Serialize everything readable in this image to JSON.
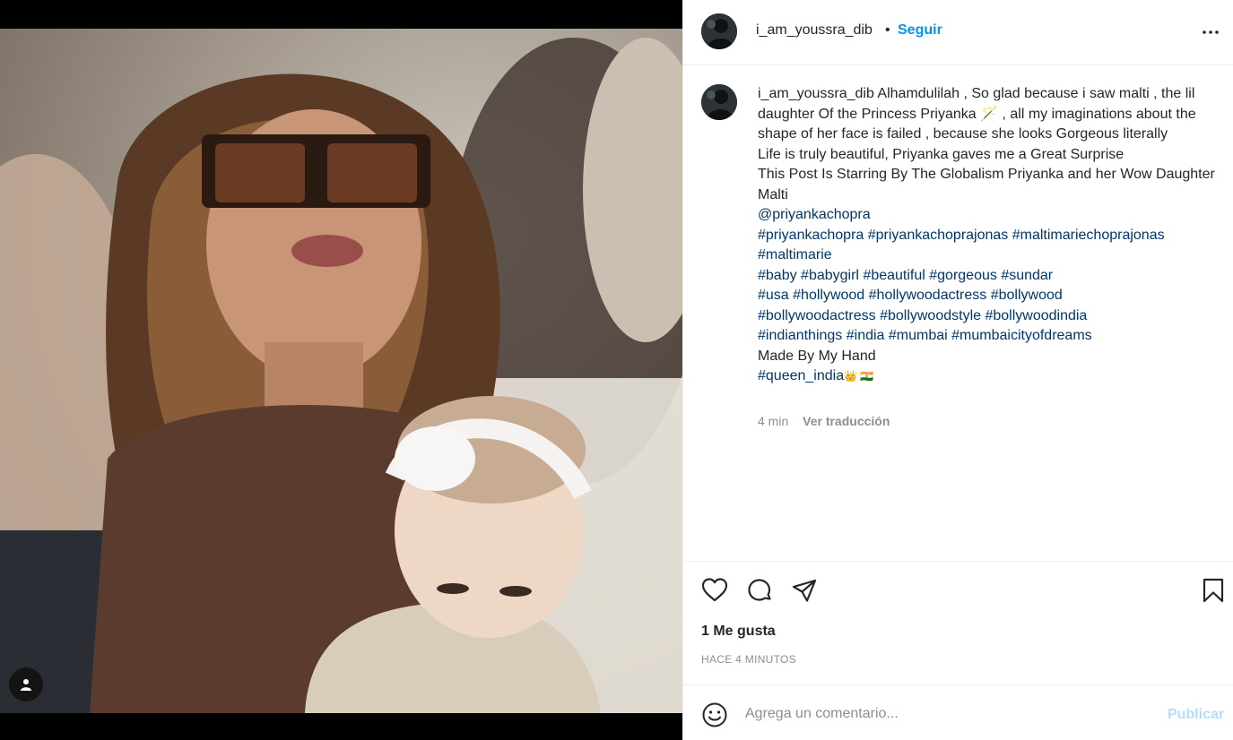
{
  "post": {
    "username": "i_am_youssra_dib",
    "separator": "•",
    "follow_label": "Seguir",
    "more_icon": "more-horizontal-icon"
  },
  "caption": {
    "username": "i_am_youssra_dib",
    "text_1": " Alhamdulilah , So glad because i saw malti , the lil daughter Of the Princess Priyanka 🪄 , all my imaginations about the shape of her face is failed , because she looks Gorgeous literally",
    "line_2": "Life is truly beautiful, Priyanka gaves me a Great Surprise",
    "line_3": "This Post Is Starring By The Globalism Priyanka and her Wow Daughter Malti",
    "mention": "@priyankachopra",
    "tags_1": "#priyankachopra #priyankachoprajonas #maltimariechoprajonas #maltimarie",
    "tags_2": "#baby #babygirl #beautiful #gorgeous #sundar",
    "tags_3": "#usa #hollywood #hollywoodactress #bollywood",
    "tags_4": "#bollywoodactress #bollywoodstyle #bollywoodindia",
    "tags_5": "#indianthings #india #mumbai #mumbaicityofdreams",
    "line_4": "Made By My Hand",
    "tags_6": "#queen_india",
    "tags_6_suffix": "👑 🇮🇳",
    "age": "4 min",
    "translate_label": "Ver traducción"
  },
  "actions": {
    "like_icon": "heart-icon",
    "comment_icon": "comment-icon",
    "share_icon": "share-icon",
    "save_icon": "bookmark-icon",
    "likes_text": "1 Me gusta",
    "timestamp": "HACE 4 MINUTOS"
  },
  "comment": {
    "placeholder": "Agrega un comentario...",
    "publish_label": "Publicar",
    "emoji_icon": "emoji-icon"
  }
}
